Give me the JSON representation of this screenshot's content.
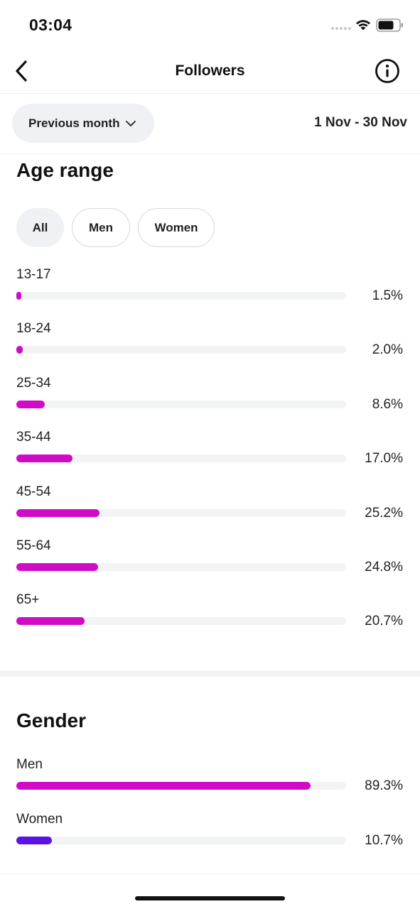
{
  "status_bar": {
    "time": "03:04"
  },
  "nav": {
    "title": "Followers"
  },
  "filter": {
    "period_label": "Previous month",
    "date_range": "1 Nov - 30 Nov"
  },
  "age_section": {
    "title": "Age range",
    "chips": [
      {
        "label": "All",
        "active": true
      },
      {
        "label": "Men",
        "active": false
      },
      {
        "label": "Women",
        "active": false
      }
    ],
    "rows": [
      {
        "label": "13-17",
        "value_text": "1.5%",
        "value": 1.5
      },
      {
        "label": "18-24",
        "value_text": "2.0%",
        "value": 2.0
      },
      {
        "label": "25-34",
        "value_text": "8.6%",
        "value": 8.6
      },
      {
        "label": "35-44",
        "value_text": "17.0%",
        "value": 17.0
      },
      {
        "label": "45-54",
        "value_text": "25.2%",
        "value": 25.2
      },
      {
        "label": "55-64",
        "value_text": "24.8%",
        "value": 24.8
      },
      {
        "label": "65+",
        "value_text": "20.7%",
        "value": 20.7
      }
    ],
    "bar_color": "#d10ac6"
  },
  "gender_section": {
    "title": "Gender",
    "rows": [
      {
        "label": "Men",
        "value_text": "89.3%",
        "value": 89.3,
        "color": "#d10ac6"
      },
      {
        "label": "Women",
        "value_text": "10.7%",
        "value": 10.7,
        "color": "#5b12e6"
      }
    ]
  },
  "colors": {
    "track": "#f2f3f5",
    "accent_magenta": "#d10ac6",
    "accent_purple": "#5b12e6"
  }
}
